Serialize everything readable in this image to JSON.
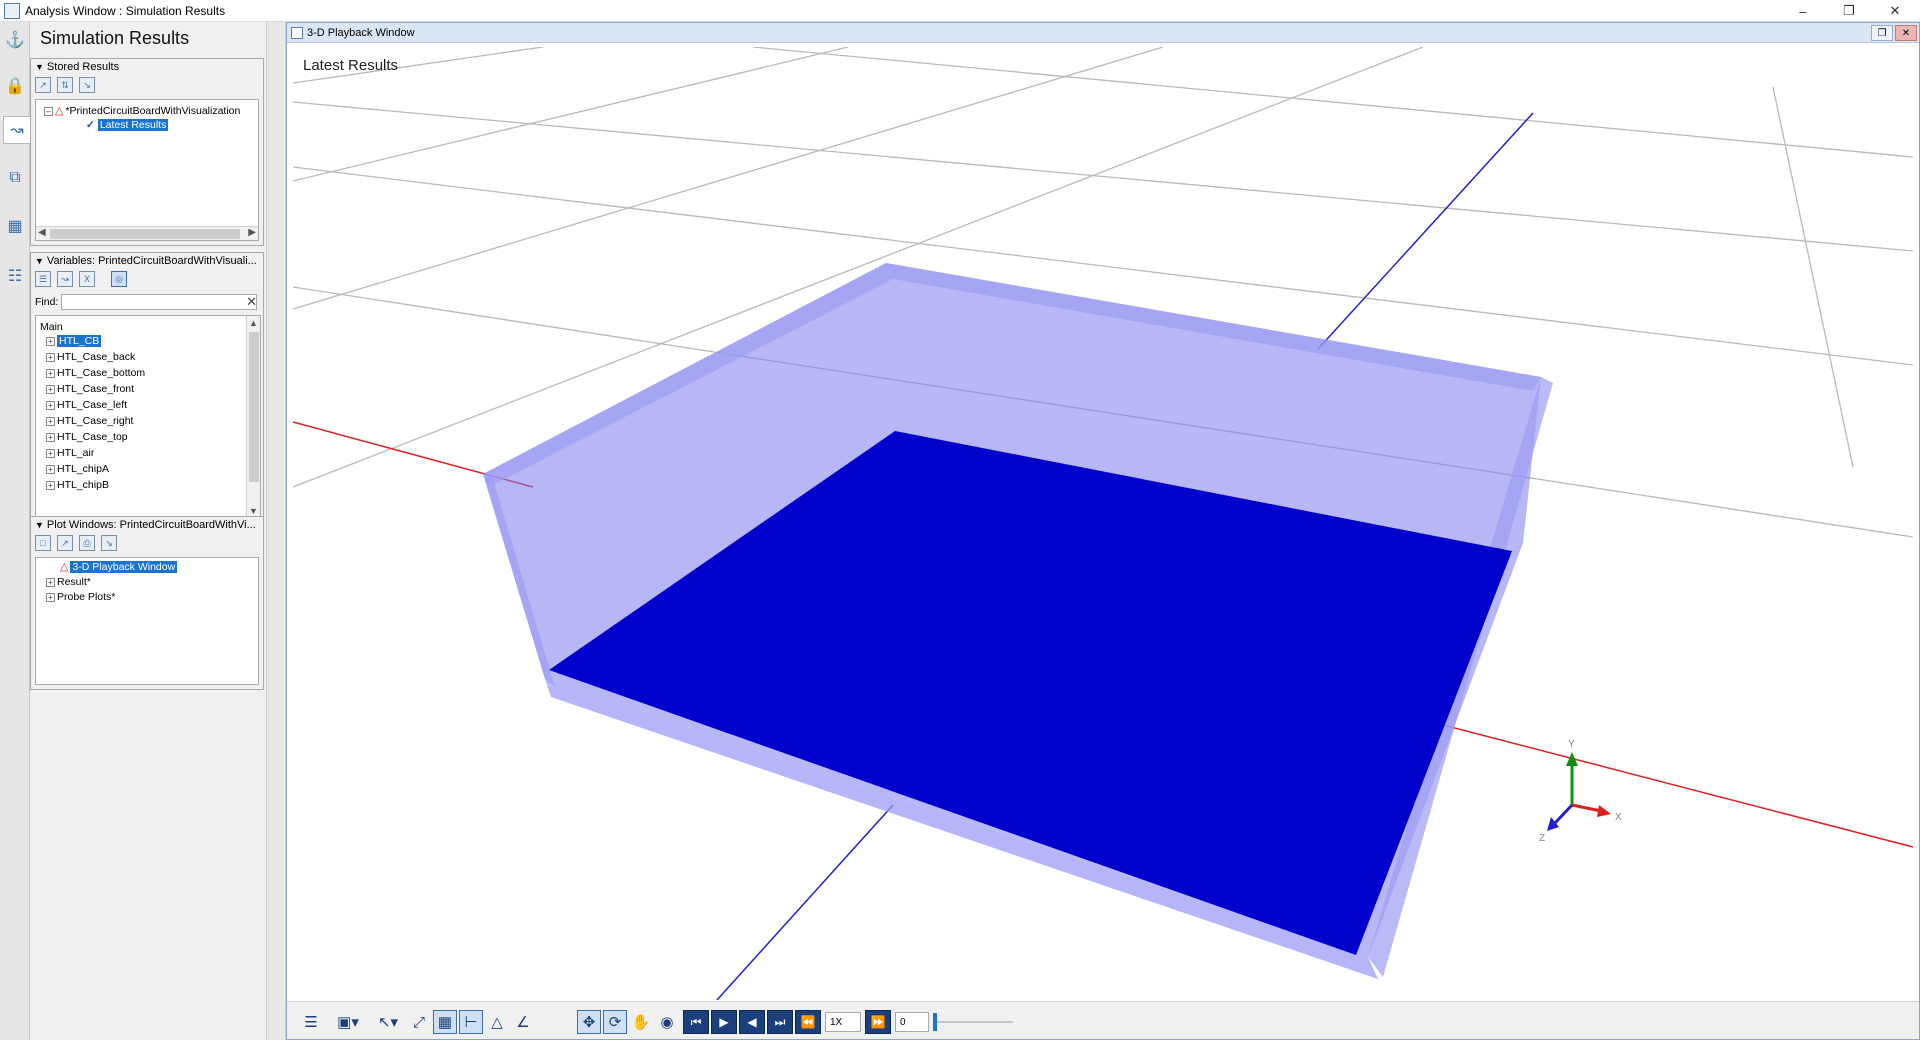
{
  "window": {
    "title": "Analysis Window : Simulation Results"
  },
  "panel": {
    "title": "Simulation Results"
  },
  "stored_results": {
    "header": "Stored Results",
    "root": "*PrintedCircuitBoardWithVisualization",
    "child": "Latest Results"
  },
  "variables": {
    "header": "Variables: PrintedCircuitBoardWithVisuali...",
    "find_label": "Find:",
    "find_value": "",
    "root": "Main",
    "items": [
      "HTL_CB",
      "HTL_Case_back",
      "HTL_Case_bottom",
      "HTL_Case_front",
      "HTL_Case_left",
      "HTL_Case_right",
      "HTL_Case_top",
      "HTL_air",
      "HTL_chipA",
      "HTL_chipB"
    ]
  },
  "plot_windows": {
    "header": "Plot Windows: PrintedCircuitBoardWithVi...",
    "items": [
      "3-D Playback Window",
      "Result*",
      "Probe Plots*"
    ]
  },
  "playback": {
    "window_title": "3-D Playback Window",
    "viewport_label": "Latest Results",
    "speed": "1X",
    "time_value": "0",
    "axis_labels": {
      "x": "X",
      "y": "Y",
      "z": "Z"
    }
  },
  "colors": {
    "board": "#0000cc",
    "case": "#7b7bef",
    "x_axis": "#e02020",
    "z_axis": "#2020d0",
    "grid": "#b9b9b9"
  }
}
